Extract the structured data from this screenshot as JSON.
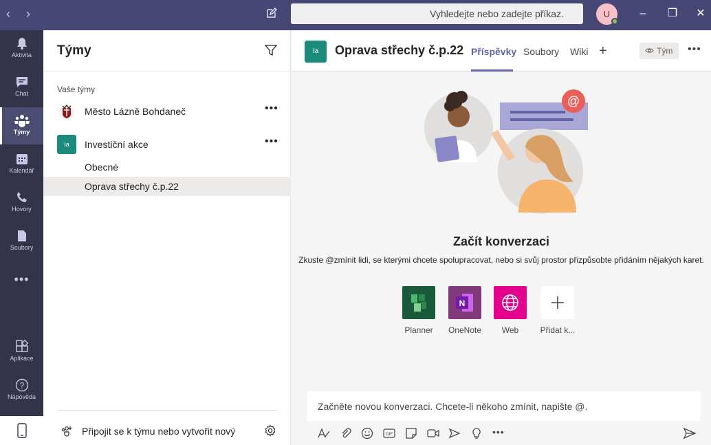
{
  "titlebar": {
    "search_placeholder": "Vyhledejte nebo zadejte příkaz.",
    "avatar_initial": "U",
    "status_color": "#92c353",
    "window_controls": [
      "–",
      "❐",
      "✕"
    ]
  },
  "appbar": {
    "items": [
      {
        "label": "Aktivita",
        "icon": "bell-icon"
      },
      {
        "label": "Chat",
        "icon": "chat-icon"
      },
      {
        "label": "Týmy",
        "icon": "teams-icon",
        "active": true
      },
      {
        "label": "Kalendář",
        "icon": "calendar-icon"
      },
      {
        "label": "Hovory",
        "icon": "phone-icon"
      },
      {
        "label": "Soubory",
        "icon": "file-icon"
      }
    ],
    "more": "•••",
    "apps_label": "Aplikace",
    "help_label": "Nápověda"
  },
  "teams_pane": {
    "title": "Týmy",
    "section_label": "Vaše týmy",
    "teams": [
      {
        "name": "Město Lázně Bohdaneč",
        "more": "•••"
      },
      {
        "name": "Investiční akce",
        "avatar": "Ia",
        "more": "•••"
      }
    ],
    "channels": [
      {
        "name": "Obecné"
      },
      {
        "name": "Oprava střechy č.p.22",
        "active": true
      }
    ],
    "join_label": "Připojit se k týmu nebo vytvořit nový"
  },
  "channel": {
    "avatar": "Ia",
    "title": "Oprava střechy č.p.22",
    "tabs": [
      {
        "label": "Příspěvky",
        "active": true
      },
      {
        "label": "Soubory"
      },
      {
        "label": "Wiki"
      }
    ],
    "add_tab": "+",
    "team_button": "Tým",
    "more": "•••",
    "start_title": "Začít konverzaci",
    "start_subtitle": "Zkuste @zmínit lidi, se kterými chcete spolupracovat, nebo si svůj prostor přizpůsobte přidáním nějakých karet.",
    "apps": [
      {
        "label": "Planner",
        "color": "#185a3a",
        "icon": "planner-icon"
      },
      {
        "label": "OneNote",
        "color": "#80397b",
        "icon": "onenote-icon"
      },
      {
        "label": "Web",
        "color": "#e3008c",
        "icon": "globe-icon"
      },
      {
        "label": "Přidat k...",
        "color": "#ffffff",
        "icon": "plus-icon"
      }
    ],
    "composer_placeholder": "Začněte novou konverzaci. Chcete-li někoho zmínit, napište @."
  },
  "colors": {
    "titlebar": "#464775",
    "appbar": "#33344a",
    "accent": "#6264a7",
    "team_avatar": "#1b8b7b"
  }
}
